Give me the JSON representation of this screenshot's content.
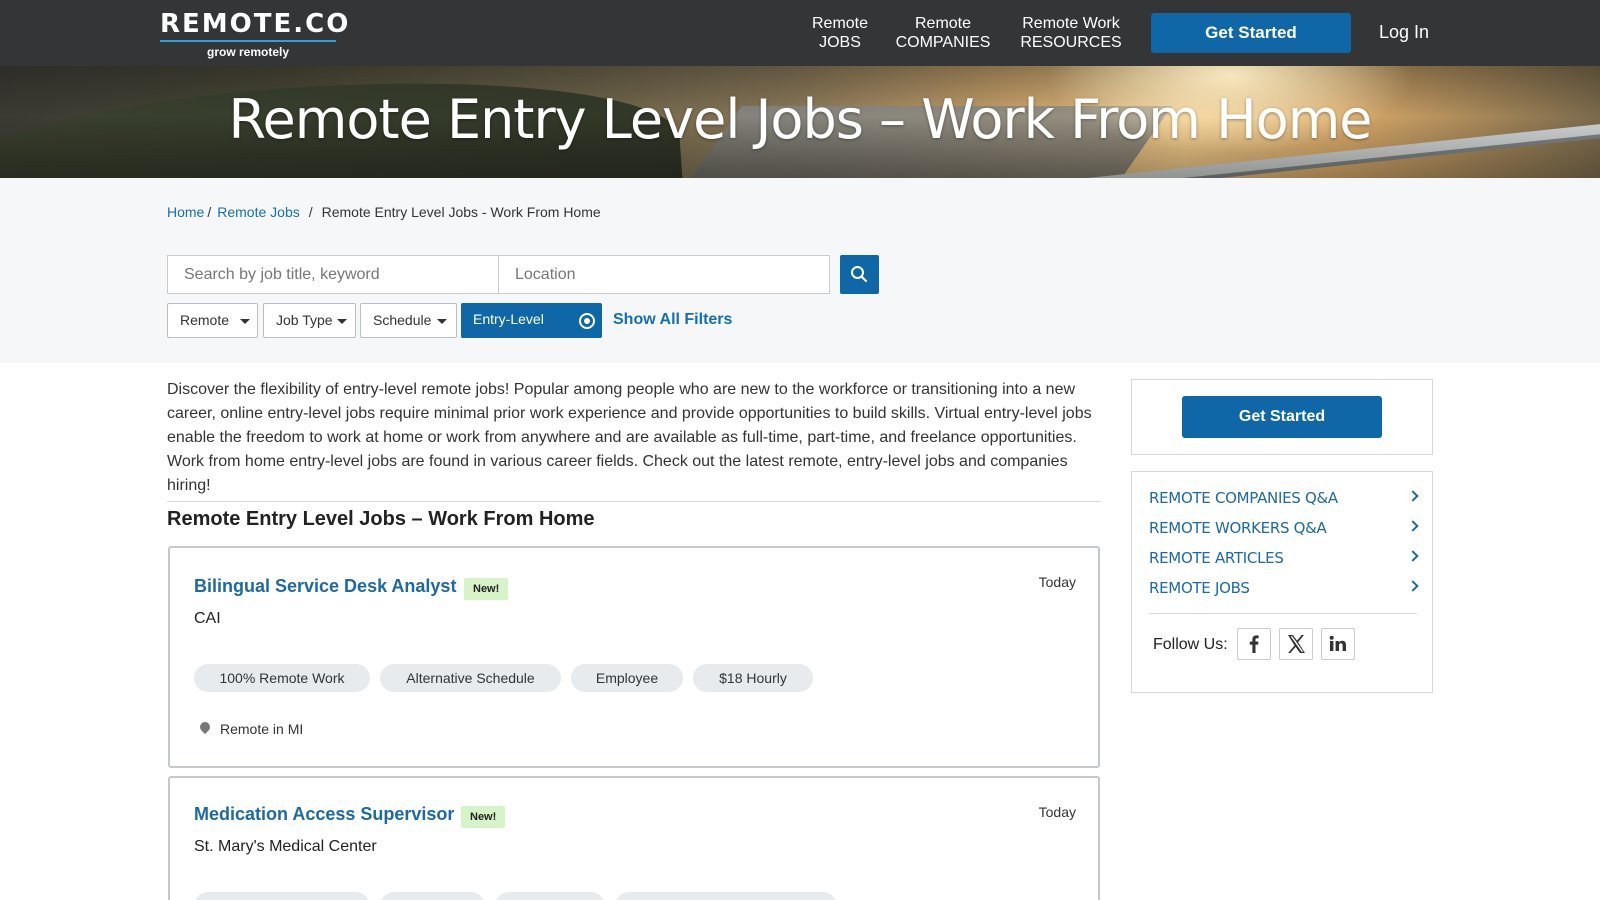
{
  "nav": {
    "logo_main": "REMOTE.CO",
    "logo_tag": "grow remotely",
    "links": [
      {
        "line1": "Remote",
        "line2": "JOBS"
      },
      {
        "line1": "Remote",
        "line2": "COMPANIES"
      },
      {
        "line1": "Remote Work",
        "line2": "RESOURCES"
      }
    ],
    "get_started": "Get Started",
    "login": "Log In"
  },
  "hero": {
    "title": "Remote Entry Level Jobs – Work From Home"
  },
  "breadcrumb": {
    "home": "Home",
    "jobs": "Remote Jobs",
    "current": "Remote Entry Level Jobs - Work From Home",
    "sep": "/"
  },
  "search": {
    "keyword_placeholder": "Search by job title, keyword",
    "location_placeholder": "Location"
  },
  "filters": {
    "remote": "Remote",
    "job_type": "Job Type",
    "schedule": "Schedule",
    "active": "Entry-Level",
    "show_all": "Show All Filters"
  },
  "main": {
    "intro": "Discover the flexibility of entry-level remote jobs! Popular among people who are new to the workforce or transitioning into a new career, online entry-level jobs require minimal prior work experience and provide opportunities to build skills. Virtual entry-level jobs enable the freedom to work at home or work from anywhere and are available as full-time, part-time, and freelance opportunities. Work from home entry-level jobs are found in various career fields. Check out the latest remote, entry-level jobs and companies hiring!",
    "section_title": "Remote Entry Level Jobs – Work From Home"
  },
  "jobs": [
    {
      "title": "Bilingual Service Desk Analyst",
      "badge": "New!",
      "company": "CAI",
      "date": "Today",
      "tags": [
        "100% Remote Work",
        "Alternative Schedule",
        "Employee",
        "$18 Hourly"
      ],
      "location": "Remote in MI"
    },
    {
      "title": "Medication Access Supervisor",
      "badge": "New!",
      "company": "St. Mary's Medical Center",
      "date": "Today"
    }
  ],
  "sidebar": {
    "get_started": "Get Started",
    "links": [
      "REMOTE COMPANIES Q&A",
      "REMOTE WORKERS Q&A",
      "REMOTE ARTICLES",
      "REMOTE JOBS"
    ],
    "follow": "Follow Us:",
    "social": [
      "facebook-icon",
      "x-icon",
      "linkedin-icon"
    ]
  },
  "colors": {
    "nav_bg": "#333536",
    "brand_blue": "#0f67a8",
    "link_blue": "#1c6aa3",
    "badge_green": "#d7f3c8"
  }
}
